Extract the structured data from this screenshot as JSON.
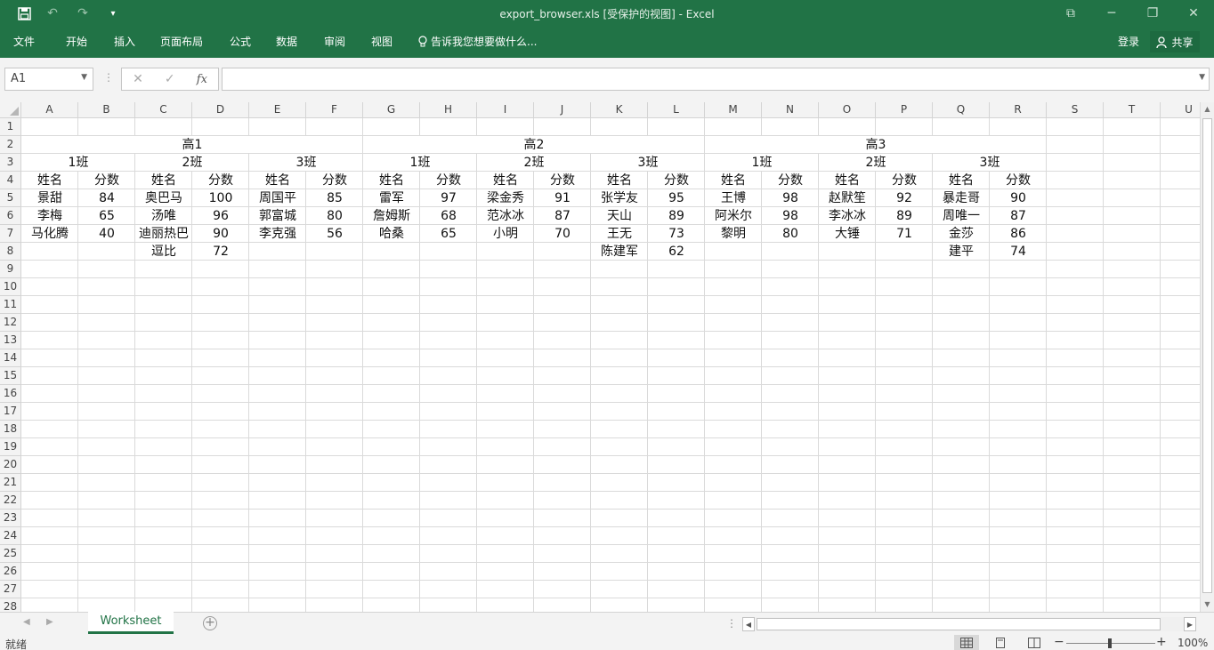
{
  "titlebar": {
    "title": "export_browser.xls  [受保护的视图] - Excel",
    "icons": [
      "save-icon",
      "undo-icon",
      "redo-icon",
      "customize-icon"
    ]
  },
  "ribbon": {
    "tabs": [
      "文件",
      "开始",
      "插入",
      "页面布局",
      "公式",
      "数据",
      "审阅",
      "视图"
    ],
    "tell_me": "告诉我您想要做什么...",
    "sign_in": "登录",
    "share": "共享"
  },
  "formula_bar": {
    "name_box": "A1",
    "fx": "fx",
    "formula": ""
  },
  "columns": [
    "A",
    "B",
    "C",
    "D",
    "E",
    "F",
    "G",
    "H",
    "I",
    "J",
    "K",
    "L",
    "M",
    "N",
    "O",
    "P",
    "Q",
    "R",
    "S",
    "T",
    "U"
  ],
  "rows": [
    "1",
    "2",
    "3",
    "4",
    "5",
    "6",
    "7",
    "8",
    "9",
    "10",
    "11",
    "12",
    "13",
    "14",
    "15",
    "16",
    "17",
    "18",
    "19",
    "20",
    "21",
    "22",
    "23",
    "24",
    "25",
    "26",
    "27",
    "28"
  ],
  "sheet": {
    "grades": [
      "高1",
      "高2",
      "高3"
    ],
    "classes": [
      "1班",
      "2班",
      "3班",
      "1班",
      "2班",
      "3班",
      "1班",
      "2班",
      "3班"
    ],
    "headers": [
      "姓名",
      "分数",
      "姓名",
      "分数",
      "姓名",
      "分数",
      "姓名",
      "分数",
      "姓名",
      "分数",
      "姓名",
      "分数",
      "姓名",
      "分数",
      "姓名",
      "分数",
      "姓名",
      "分数"
    ],
    "data": [
      [
        "景甜",
        "84",
        "奥巴马",
        "100",
        "周国平",
        "85",
        "雷军",
        "97",
        "梁金秀",
        "91",
        "张学友",
        "95",
        "王博",
        "98",
        "赵默笙",
        "92",
        "暴走哥",
        "90"
      ],
      [
        "李梅",
        "65",
        "汤唯",
        "96",
        "郭富城",
        "80",
        "詹姆斯",
        "68",
        "范冰冰",
        "87",
        "天山",
        "89",
        "阿米尔",
        "98",
        "李冰冰",
        "89",
        "周唯一",
        "87"
      ],
      [
        "马化腾",
        "40",
        "迪丽热巴",
        "90",
        "李克强",
        "56",
        "哈桑",
        "65",
        "小明",
        "70",
        "王无",
        "73",
        "黎明",
        "80",
        "大锤",
        "71",
        "金莎",
        "86"
      ],
      [
        "",
        "",
        "逗比",
        "72",
        "",
        "",
        "",
        "",
        "",
        "",
        "陈建军",
        "62",
        "",
        "",
        "",
        "",
        "建平",
        "74"
      ]
    ]
  },
  "sheet_tabs": {
    "active": "Worksheet"
  },
  "status": {
    "ready": "就绪",
    "zoom": "100%",
    "zoom_fraction": 0.5
  }
}
